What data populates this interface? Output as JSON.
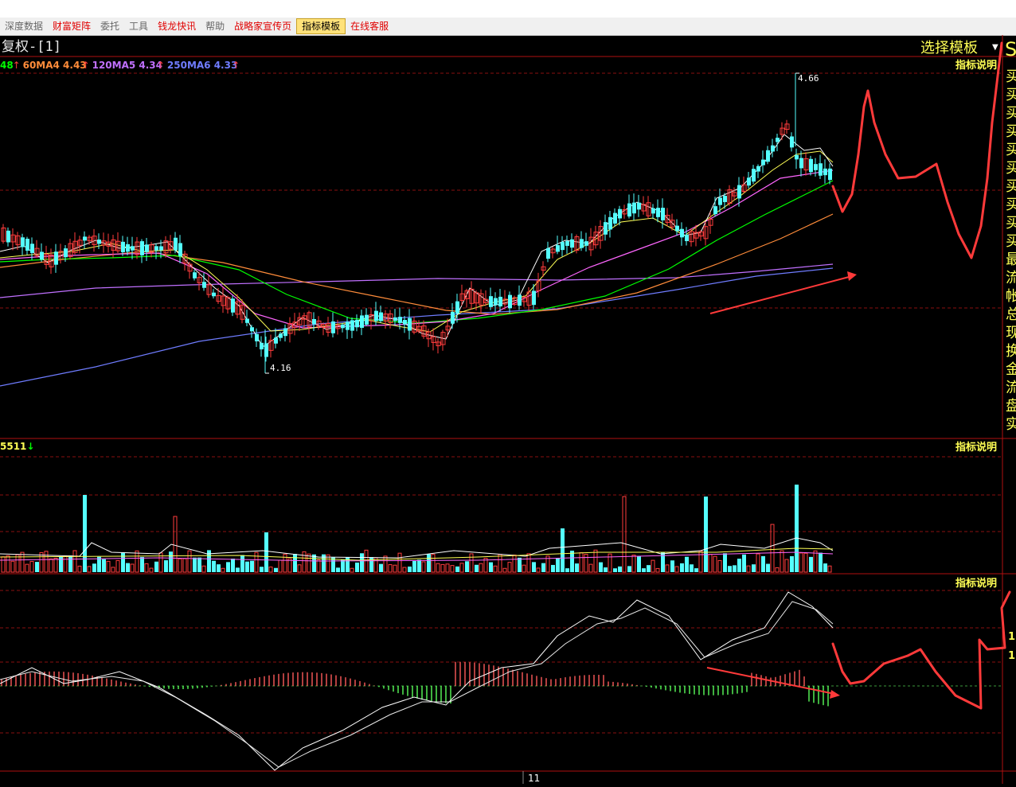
{
  "menu": [
    {
      "label": "深度数据",
      "style": "dark"
    },
    {
      "label": "财富矩阵",
      "style": "red"
    },
    {
      "label": "委托",
      "style": "dark"
    },
    {
      "label": "工具",
      "style": "dark"
    },
    {
      "label": "钱龙快讯",
      "style": "red"
    },
    {
      "label": "帮助",
      "style": "dark"
    },
    {
      "label": "战略家宣传页",
      "style": "red"
    },
    {
      "label": "指标模板",
      "style": "active"
    },
    {
      "label": "在线客服",
      "style": "red"
    }
  ],
  "header": {
    "title": "复权-[1]",
    "select_template": "选择模板",
    "select_arrow": "▼",
    "edge_char": "S"
  },
  "ma_legend": [
    {
      "label": "48",
      "arrow": "↑",
      "color": "#00ff00"
    },
    {
      "label": "60MA4 4.43",
      "arrow": "↑",
      "color": "#ff8c3a"
    },
    {
      "label": "120MA5 4.34",
      "arrow": "↑",
      "color": "#c070ff"
    },
    {
      "label": "250MA6 4.33",
      "arrow": "↑",
      "color": "#6f7cff"
    }
  ],
  "indicator_help": "指标说明",
  "price_high_label": "4.66",
  "price_low_label": "4.16",
  "volume_label": "5511",
  "volume_arrow": "↓",
  "right_column_chars": [
    "买",
    "买",
    "买",
    "买",
    "买",
    "买",
    "买",
    "买",
    "买",
    "买",
    "最",
    "流",
    "帐",
    "总",
    "现",
    "换",
    "金",
    "流",
    "盘",
    "实"
  ],
  "right_macd_values": [
    "1",
    "1"
  ],
  "time_label": "11",
  "colors": {
    "up": "#ff3d3d",
    "down": "#54ffff",
    "grid": "#8a1010",
    "border": "#b01010",
    "annotation": "#ff3a3a",
    "ma5": "#ffffff",
    "ma10": "#ffff55",
    "ma20": "#ff66ff",
    "ma30": "#00ff00",
    "ma60": "#ff8c3a",
    "ma120": "#c070ff",
    "ma250": "#6f7cff",
    "help_text": "#ffff55",
    "macd_pos": "#ff5a5a",
    "macd_neg": "#5aff5a"
  },
  "chart_data": {
    "type": "candlestick",
    "bars": 180,
    "price_ylim": [
      4.1,
      4.7
    ],
    "price_high": 4.66,
    "price_low": 4.16,
    "ma_values": {
      "MA4": 4.43,
      "MA5": 4.34,
      "MA6": 4.33
    },
    "volume_value": 5511,
    "x_tick": "11"
  }
}
